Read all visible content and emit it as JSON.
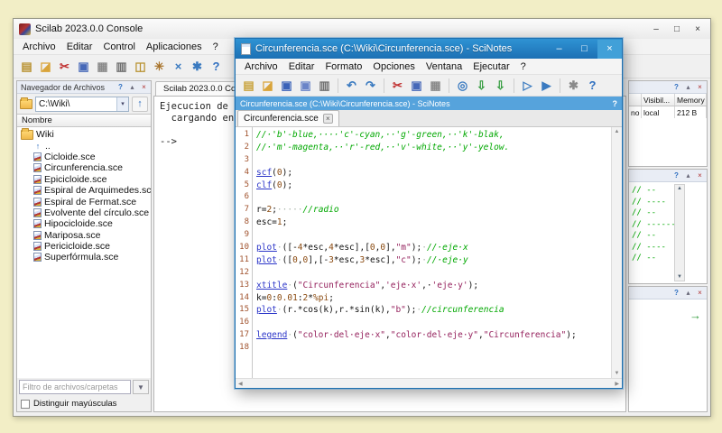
{
  "desktop": {
    "bg": "#f2eec6"
  },
  "icons": {
    "funnel_glyph": "▼",
    "up_arrow_glyph": "↑",
    "combo_arrow_glyph": "▾",
    "green_arrow_glyph": "→",
    "scroll_up_glyph": "▲",
    "scroll_down_glyph": "▼",
    "scroll_left_glyph": "◀",
    "scroll_right_glyph": "▶",
    "tab_close_glyph": "×",
    "infobar_help_glyph": "?"
  },
  "panel_icons": [
    {
      "name": "panel-help-icon",
      "glyph": "?"
    },
    {
      "name": "panel-undock-icon",
      "glyph": "▴"
    },
    {
      "name": "panel-close-icon",
      "glyph": "×"
    }
  ],
  "scilab": {
    "title": "Scilab 2023.0.0 Console",
    "window_buttons": [
      {
        "name": "minimize-button",
        "glyph": "–"
      },
      {
        "name": "maximize-button",
        "glyph": "□"
      },
      {
        "name": "close-button",
        "glyph": "×"
      }
    ],
    "menus": [
      "Archivo",
      "Editar",
      "Control",
      "Aplicaciones",
      "?"
    ],
    "toolbar": [
      {
        "name": "launch-editor-icon",
        "glyph": "▤",
        "fg": "#b8912f"
      },
      {
        "name": "open-file-icon",
        "glyph": "◪",
        "fg": "#d9a43a"
      },
      {
        "name": "cut-icon",
        "glyph": "✂",
        "fg": "#c03030"
      },
      {
        "name": "copy-icon",
        "glyph": "▣",
        "fg": "#4668b8"
      },
      {
        "name": "paste-icon",
        "glyph": "▦",
        "fg": "#8a8a8a"
      },
      {
        "name": "print-icon",
        "glyph": "▥",
        "fg": "#707070"
      },
      {
        "name": "change-directory-icon",
        "glyph": "◫",
        "fg": "#b8912f"
      },
      {
        "name": "clear-console-icon",
        "glyph": "✳",
        "fg": "#a8742c"
      },
      {
        "name": "abort-icon",
        "glyph": "×",
        "fg": "#3a7ac0"
      },
      {
        "name": "preferences-icon",
        "glyph": "✱",
        "fg": "#3a7ac0"
      },
      {
        "name": "help-icon",
        "glyph": "?",
        "fg": "#2f6fc0"
      }
    ],
    "file_browser": {
      "title": "Navegador de Archivos",
      "path": "C:\\Wiki\\",
      "column": "Nombre",
      "root": "Wiki",
      "up_item": "..",
      "files": [
        "Cicloide.sce",
        "Circunferencia.sce",
        "Epicicloide.sce",
        "Espiral de Arquimedes.sce",
        "Espiral de Fermat.sce",
        "Evolvente del círculo.sce",
        "Hipocicloide.sce",
        "Mariposa.sce",
        "Pericicloide.sce",
        "Superfórmula.sce"
      ],
      "filter_placeholder": "Filtro de archivos/carpetas",
      "case_checkbox": "Distinguir mayúsculas"
    },
    "console": {
      "tab": "Scilab 2023.0.0 Conso...",
      "lines": [
        "Ejecucion de i",
        "  cargando ent",
        "",
        "-->"
      ]
    },
    "variable_browser": {
      "headers": [
        "Visibil...",
        "Memory"
      ],
      "row": [
        "no",
        "local",
        "212 B"
      ]
    },
    "history": {
      "lines": [
        "// --",
        "// ----",
        "// --",
        "// ------",
        "// --",
        "// ----",
        "// --"
      ]
    }
  },
  "scinotes": {
    "title": "Circunferencia.sce (C:\\Wiki\\Circunferencia.sce) - SciNotes",
    "window_buttons": [
      {
        "name": "minimize-button",
        "glyph": "–"
      },
      {
        "name": "maximize-button",
        "glyph": "□"
      },
      {
        "name": "close-button",
        "glyph": "×",
        "cls": "close"
      }
    ],
    "menus": [
      "Archivo",
      "Editar",
      "Formato",
      "Opciones",
      "Ventana",
      "Ejecutar",
      "?"
    ],
    "toolbar": [
      {
        "name": "new-file-icon",
        "glyph": "▤",
        "fg": "#c8a23a"
      },
      {
        "name": "open-file-icon",
        "glyph": "◪",
        "fg": "#d9a43a"
      },
      {
        "name": "save-icon",
        "glyph": "▣",
        "fg": "#3a62b8"
      },
      {
        "name": "save-as-icon",
        "glyph": "▣",
        "fg": "#6a84c8"
      },
      {
        "name": "print-icon",
        "glyph": "▥",
        "fg": "#707070"
      },
      {
        "sep": true
      },
      {
        "name": "undo-icon",
        "glyph": "↶",
        "fg": "#3a7ac0"
      },
      {
        "name": "redo-icon",
        "glyph": "↷",
        "fg": "#3a7ac0"
      },
      {
        "sep": true
      },
      {
        "name": "cut-icon",
        "glyph": "✂",
        "fg": "#c03030"
      },
      {
        "name": "copy-icon",
        "glyph": "▣",
        "fg": "#4668b8"
      },
      {
        "name": "paste-icon",
        "glyph": "▦",
        "fg": "#8a8a8a"
      },
      {
        "sep": true
      },
      {
        "name": "search-icon",
        "glyph": "◎",
        "fg": "#3a7ac0"
      },
      {
        "name": "import-icon",
        "glyph": "⇩",
        "fg": "#2f9a3a"
      },
      {
        "name": "export-icon",
        "glyph": "⇩",
        "fg": "#2f9a3a"
      },
      {
        "sep": true
      },
      {
        "name": "execute-save-icon",
        "glyph": "▷",
        "fg": "#3a7ac0"
      },
      {
        "name": "execute-icon",
        "glyph": "▶",
        "fg": "#3a7ac0"
      },
      {
        "sep": true
      },
      {
        "name": "settings-icon",
        "glyph": "✱",
        "fg": "#8a8a8a"
      },
      {
        "name": "help-icon",
        "glyph": "?",
        "fg": "#2f6fc0"
      }
    ],
    "infobar": "Circunferencia.sce (C:\\Wiki\\Circunferencia.sce) - SciNotes",
    "tab": "Circunferencia.sce",
    "code": {
      "lines": [
        [
          {
            "c": "cm",
            "t": "//·'b'-blue,····'c'-cyan,··'g'-green,··'k'-blak,"
          }
        ],
        [
          {
            "c": "cm",
            "t": "//·'m'-magenta,··'r'-red,··'v'-white,··'y'-yelow."
          }
        ],
        [],
        [
          {
            "c": "fn",
            "t": "scf"
          },
          {
            "c": "pl",
            "t": "("
          },
          {
            "c": "num",
            "t": "0"
          },
          {
            "c": "pl",
            "t": ");"
          }
        ],
        [
          {
            "c": "fn",
            "t": "clf"
          },
          {
            "c": "pl",
            "t": "("
          },
          {
            "c": "num",
            "t": "0"
          },
          {
            "c": "pl",
            "t": ");"
          }
        ],
        [],
        [
          {
            "c": "pl",
            "t": "r="
          },
          {
            "c": "num",
            "t": "2"
          },
          {
            "c": "pl",
            "t": ";"
          },
          {
            "c": "ws",
            "t": "·····"
          },
          {
            "c": "cm",
            "t": "//radio"
          }
        ],
        [
          {
            "c": "pl",
            "t": "esc="
          },
          {
            "c": "num",
            "t": "1"
          },
          {
            "c": "pl",
            "t": ";"
          }
        ],
        [],
        [
          {
            "c": "fn",
            "t": "plot"
          },
          {
            "c": "ws",
            "t": "·"
          },
          {
            "c": "pl",
            "t": "([-"
          },
          {
            "c": "num",
            "t": "4"
          },
          {
            "c": "pl",
            "t": "*esc,"
          },
          {
            "c": "num",
            "t": "4"
          },
          {
            "c": "pl",
            "t": "*esc],["
          },
          {
            "c": "num",
            "t": "0"
          },
          {
            "c": "pl",
            "t": ","
          },
          {
            "c": "num",
            "t": "0"
          },
          {
            "c": "pl",
            "t": "],"
          },
          {
            "c": "str",
            "t": "\"m\""
          },
          {
            "c": "pl",
            "t": ");"
          },
          {
            "c": "ws",
            "t": "·"
          },
          {
            "c": "cm",
            "t": "//·eje·x"
          }
        ],
        [
          {
            "c": "fn",
            "t": "plot"
          },
          {
            "c": "ws",
            "t": "·"
          },
          {
            "c": "pl",
            "t": "(["
          },
          {
            "c": "num",
            "t": "0"
          },
          {
            "c": "pl",
            "t": ","
          },
          {
            "c": "num",
            "t": "0"
          },
          {
            "c": "pl",
            "t": "],[-"
          },
          {
            "c": "num",
            "t": "3"
          },
          {
            "c": "pl",
            "t": "*esc,"
          },
          {
            "c": "num",
            "t": "3"
          },
          {
            "c": "pl",
            "t": "*esc],"
          },
          {
            "c": "str",
            "t": "\"c\""
          },
          {
            "c": "pl",
            "t": ");"
          },
          {
            "c": "ws",
            "t": "·"
          },
          {
            "c": "cm",
            "t": "//·eje·y"
          }
        ],
        [],
        [
          {
            "c": "fn",
            "t": "xtitle"
          },
          {
            "c": "ws",
            "t": "·"
          },
          {
            "c": "pl",
            "t": "("
          },
          {
            "c": "str",
            "t": "\"Circunferencia\""
          },
          {
            "c": "pl",
            "t": ","
          },
          {
            "c": "str",
            "t": "'eje·x'"
          },
          {
            "c": "pl",
            "t": ",·"
          },
          {
            "c": "str",
            "t": "'eje·y'"
          },
          {
            "c": "pl",
            "t": ");"
          }
        ],
        [
          {
            "c": "pl",
            "t": "k="
          },
          {
            "c": "num",
            "t": "0"
          },
          {
            "c": "pl",
            "t": ":"
          },
          {
            "c": "num",
            "t": "0.01"
          },
          {
            "c": "pl",
            "t": ":"
          },
          {
            "c": "num",
            "t": "2"
          },
          {
            "c": "pl",
            "t": "*"
          },
          {
            "c": "num",
            "t": "%pi"
          },
          {
            "c": "pl",
            "t": ";"
          }
        ],
        [
          {
            "c": "fn",
            "t": "plot"
          },
          {
            "c": "ws",
            "t": "·"
          },
          {
            "c": "pl",
            "t": "(r.*cos(k),r.*sin(k),"
          },
          {
            "c": "str",
            "t": "\"b\""
          },
          {
            "c": "pl",
            "t": ");"
          },
          {
            "c": "ws",
            "t": "·"
          },
          {
            "c": "cm",
            "t": "//circunferencia"
          }
        ],
        [],
        [
          {
            "c": "fn",
            "t": "legend"
          },
          {
            "c": "ws",
            "t": "·"
          },
          {
            "c": "pl",
            "t": "("
          },
          {
            "c": "str",
            "t": "\"color·del·eje·x\""
          },
          {
            "c": "pl",
            "t": ","
          },
          {
            "c": "str",
            "t": "\"color·del·eje·y\""
          },
          {
            "c": "pl",
            "t": ","
          },
          {
            "c": "str",
            "t": "\"Circunferencia\""
          },
          {
            "c": "pl",
            "t": ");"
          }
        ],
        []
      ]
    }
  }
}
